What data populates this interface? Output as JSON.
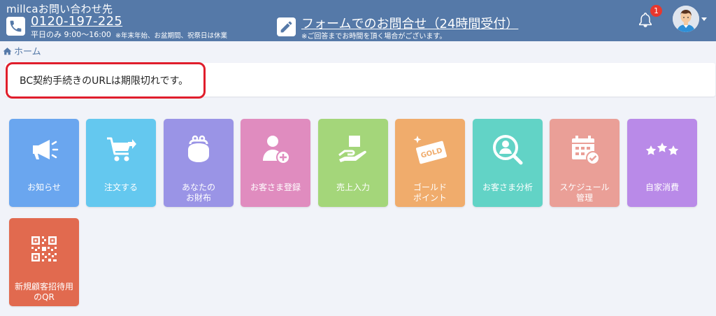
{
  "header": {
    "title": "millcaお問い合わせ先",
    "phone": "0120-197-225",
    "hours": "平日のみ 9:00〜16:00",
    "hours_note": "※年末年始、お盆期間、祝祭日は休業",
    "form_link": "フォームでのお問合せ（24時間受付）",
    "form_note": "※ご回答までお時間を頂く場合がございます。",
    "notification_count": "1"
  },
  "breadcrumb": {
    "home": "ホーム"
  },
  "alert": {
    "message": "BC契約手続きのURLは期限切れです。"
  },
  "tiles": [
    {
      "label": "お知らせ",
      "icon": "megaphone-icon",
      "color": "#6aa6ef"
    },
    {
      "label": "注文する",
      "icon": "cart-icon",
      "color": "#64c8ef"
    },
    {
      "label": "あなたの\nお財布",
      "icon": "wallet-icon",
      "color": "#9a94e6"
    },
    {
      "label": "お客さま登録",
      "icon": "add-user-icon",
      "color": "#e08cbf"
    },
    {
      "label": "売上入力",
      "icon": "box-hand-icon",
      "color": "#a4d67a"
    },
    {
      "label": "ゴールド\nポイント",
      "icon": "gold-card-icon",
      "color": "#f0ac6c"
    },
    {
      "label": "お客さま分析",
      "icon": "user-search-icon",
      "color": "#62d3c6"
    },
    {
      "label": "スケジュール\n管理",
      "icon": "calendar-check-icon",
      "color": "#ea9f97"
    },
    {
      "label": "自家消費",
      "icon": "stars-icon",
      "color": "#b98ae8"
    },
    {
      "label": "新規顧客招待用\nのQR",
      "icon": "qr-code-icon",
      "color": "#e16a4f"
    }
  ],
  "gold_card_text": "GOLD"
}
